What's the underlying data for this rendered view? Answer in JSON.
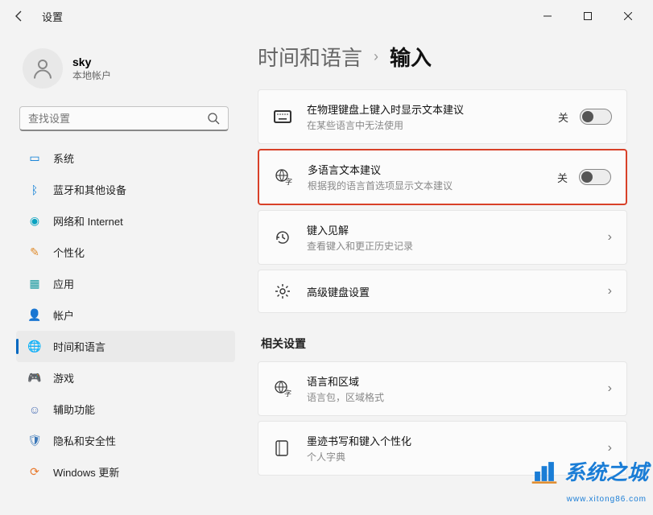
{
  "window": {
    "title": "设置"
  },
  "profile": {
    "name": "sky",
    "subtitle": "本地帐户"
  },
  "search": {
    "placeholder": "查找设置"
  },
  "nav": {
    "items": [
      {
        "label": "系统"
      },
      {
        "label": "蓝牙和其他设备"
      },
      {
        "label": "网络和 Internet"
      },
      {
        "label": "个性化"
      },
      {
        "label": "应用"
      },
      {
        "label": "帐户"
      },
      {
        "label": "时间和语言"
      },
      {
        "label": "游戏"
      },
      {
        "label": "辅助功能"
      },
      {
        "label": "隐私和安全性"
      },
      {
        "label": "Windows 更新"
      }
    ]
  },
  "breadcrumb": {
    "parent": "时间和语言",
    "current": "输入"
  },
  "cards": {
    "textSuggest": {
      "title": "在物理键盘上键入时显示文本建议",
      "sub": "在某些语言中无法使用",
      "stateLabel": "关"
    },
    "multiLang": {
      "title": "多语言文本建议",
      "sub": "根据我的语言首选项显示文本建议",
      "stateLabel": "关"
    },
    "typingInsights": {
      "title": "键入见解",
      "sub": "查看键入和更正历史记录"
    },
    "advKeyboard": {
      "title": "高级键盘设置"
    }
  },
  "relatedLabel": "相关设置",
  "related": {
    "langRegion": {
      "title": "语言和区域",
      "sub": "语言包，区域格式"
    },
    "ink": {
      "title": "墨迹书写和键入个性化",
      "sub": "个人字典"
    }
  },
  "watermark": {
    "text": "系统之城",
    "url": "www.xitong86.com"
  }
}
